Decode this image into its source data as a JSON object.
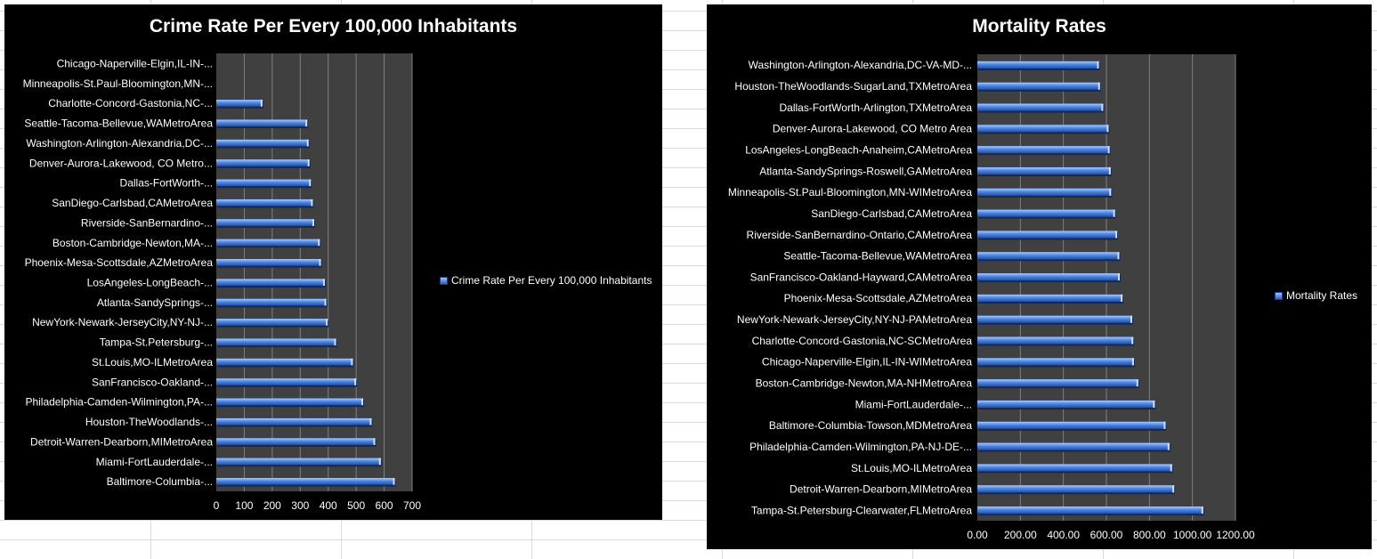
{
  "chart_data": [
    {
      "type": "bar",
      "orientation": "horizontal",
      "title": "Crime Rate Per Every 100,000 Inhabitants",
      "categories": [
        "Chicago-Naperville-Elgin,IL-IN-...",
        "Minneapolis-St.Paul-Bloomington,MN-...",
        "Charlotte-Concord-Gastonia,NC-...",
        "Seattle-Tacoma-Bellevue,WAMetroArea",
        "Washington-Arlington-Alexandria,DC-...",
        "Denver-Aurora-Lakewood, CO Metro...",
        "Dallas-FortWorth-...",
        "SanDiego-Carlsbad,CAMetroArea",
        "Riverside-SanBernardino-...",
        "Boston-Cambridge-Newton,MA-...",
        "Phoenix-Mesa-Scottsdale,AZMetroArea",
        "LosAngeles-LongBeach-...",
        "Atlanta-SandySprings-...",
        "NewYork-Newark-JerseyCity,NY-NJ-...",
        "Tampa-St.Petersburg-...",
        "St.Louis,MO-ILMetroArea",
        "SanFrancisco-Oakland-...",
        "Philadelphia-Camden-Wilmington,PA-...",
        "Houston-TheWoodlands-...",
        "Detroit-Warren-Dearborn,MIMetroArea",
        "Miami-FortLauderdale-...",
        "Baltimore-Columbia-..."
      ],
      "series": [
        {
          "name": "Crime Rate Per Every 100,000 Inhabitants",
          "values": [
            0,
            0,
            165,
            325,
            330,
            333,
            338,
            345,
            350,
            370,
            374,
            388,
            393,
            398,
            428,
            488,
            500,
            525,
            555,
            568,
            588,
            638
          ]
        }
      ],
      "xlim": [
        0,
        700
      ],
      "ticks": [
        "0",
        "100",
        "200",
        "300",
        "400",
        "500",
        "600",
        "700"
      ],
      "grid": true,
      "legend": "right"
    },
    {
      "type": "bar",
      "orientation": "horizontal",
      "title": "Mortality Rates",
      "categories": [
        "Washington-Arlington-Alexandria,DC-VA-MD-...",
        "Houston-TheWoodlands-SugarLand,TXMetroArea",
        "Dallas-FortWorth-Arlington,TXMetroArea",
        "Denver-Aurora-Lakewood, CO Metro Area",
        "LosAngeles-LongBeach-Anaheim,CAMetroArea",
        "Atlanta-SandySprings-Roswell,GAMetroArea",
        "Minneapolis-St.Paul-Bloomington,MN-WIMetroArea",
        "SanDiego-Carlsbad,CAMetroArea",
        "Riverside-SanBernardino-Ontario,CAMetroArea",
        "Seattle-Tacoma-Bellevue,WAMetroArea",
        "SanFrancisco-Oakland-Hayward,CAMetroArea",
        "Phoenix-Mesa-Scottsdale,AZMetroArea",
        "NewYork-Newark-JerseyCity,NY-NJ-PAMetroArea",
        "Charlotte-Concord-Gastonia,NC-SCMetroArea",
        "Chicago-Naperville-Elgin,IL-IN-WIMetroArea",
        "Boston-Cambridge-Newton,MA-NHMetroArea",
        "Miami-FortLauderdale-...",
        "Baltimore-Columbia-Towson,MDMetroArea",
        "Philadelphia-Camden-Wilmington,PA-NJ-DE-...",
        "St.Louis,MO-ILMetroArea",
        "Detroit-Warren-Dearborn,MIMetroArea",
        "Tampa-St.Petersburg-Clearwater,FLMetroArea"
      ],
      "series": [
        {
          "name": "Mortality Rates",
          "values": [
            565,
            570,
            585,
            610,
            615,
            620,
            622,
            640,
            650,
            660,
            662,
            675,
            720,
            725,
            728,
            748,
            825,
            875,
            893,
            905,
            915,
            1050
          ]
        }
      ],
      "xlim": [
        0,
        1200
      ],
      "ticks": [
        "0.00",
        "200.00",
        "400.00",
        "600.00",
        "800.00",
        "1000.00",
        "1200.00"
      ],
      "grid": true,
      "legend": "right"
    }
  ],
  "colors": {
    "chart_background": "#000000",
    "plot_background": "#404040",
    "gridline": "#808080",
    "bar_light": "#a9ccff",
    "bar_mid": "#4f86e0",
    "bar_dark": "#1f4fa8",
    "text": "#ffffff"
  }
}
